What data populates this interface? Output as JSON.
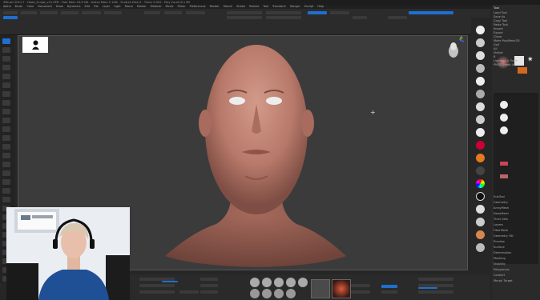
{
  "window": {
    "title": "ZBrush 2021.7 - Head_Sculpt_v12.ZPR - Free Mem 24.6 GB - Active Mem 2.1GB - Scratch Disk 0 - Timer 0.002 - Poly Count 6.1 Mil",
    "tab": "ZB 2021.7 [CN]"
  },
  "menu": [
    "Alpha",
    "Brush",
    "Color",
    "Document",
    "Draw",
    "Dynamics",
    "Edit",
    "File",
    "Layer",
    "Light",
    "Macro",
    "Marker",
    "Material",
    "Movie",
    "Picker",
    "Preferences",
    "Render",
    "Stencil",
    "Stroke",
    "Texture",
    "Tool",
    "Transform",
    "Zplugin",
    "Zscript",
    "Help"
  ],
  "topshelf": {
    "row1": [
      "Edit",
      "Draw",
      "Move",
      "Scale",
      "Rotate",
      "Mrgb",
      "Rgb",
      "M",
      "Zadd",
      "Zsub",
      "Focal Shift 0",
      "Draw Size 64",
      "Dynamic"
    ],
    "row2": [
      "Rgb Intensity 100",
      "Z Intensity 25",
      "Active Points: 6.12 Mil",
      "Total Points: 6.12 Mil",
      "Lazy Mouse",
      "Backface Mask"
    ]
  },
  "canvas": {
    "thumbnail_icon": "user-silhouette-icon",
    "cursor": "+"
  },
  "right_panel": {
    "title": "Tool",
    "items": [
      "Load Tool",
      "Save As",
      "Copy Tool",
      "Paste Tool",
      "Import",
      "Export",
      "Clone",
      "Make PolyMesh3D",
      "GoZ",
      "All",
      "Visible",
      "R",
      "Lightbox > Tools",
      "PM3D_Head 48",
      "SubTool",
      "Geometry",
      "ArrayMesh",
      "NanoMesh",
      "Thick Skin",
      "Layers",
      "FiberMesh",
      "Geometry HD",
      "Preview",
      "Surface",
      "Deformation",
      "Masking",
      "Visibility",
      "Polygroups",
      "Contact",
      "Morph Target",
      "Polypaint",
      "UV Map",
      "Texture Map",
      "Displacement Map",
      "Normal Map",
      "Vector Displacement Map",
      "Display Properties",
      "Unified Skin",
      "Initialize",
      "Import",
      "Export"
    ]
  },
  "bottom": {
    "labels": [
      "Perspective",
      "Floor",
      "Local",
      "Frame",
      "Move",
      "Scale",
      "Rotate",
      "PolyF",
      "Transp",
      "Solo",
      "Xpose"
    ],
    "brush_size": "Draw Size 64",
    "intensity": "Z Intensity 25",
    "focal": "Focal Shift 0"
  },
  "webcam": {
    "label": "presenter webcam"
  },
  "colors": {
    "accent": "#1e6fd0",
    "skin": "#c58a7a",
    "bg": "#3b3b3b"
  }
}
